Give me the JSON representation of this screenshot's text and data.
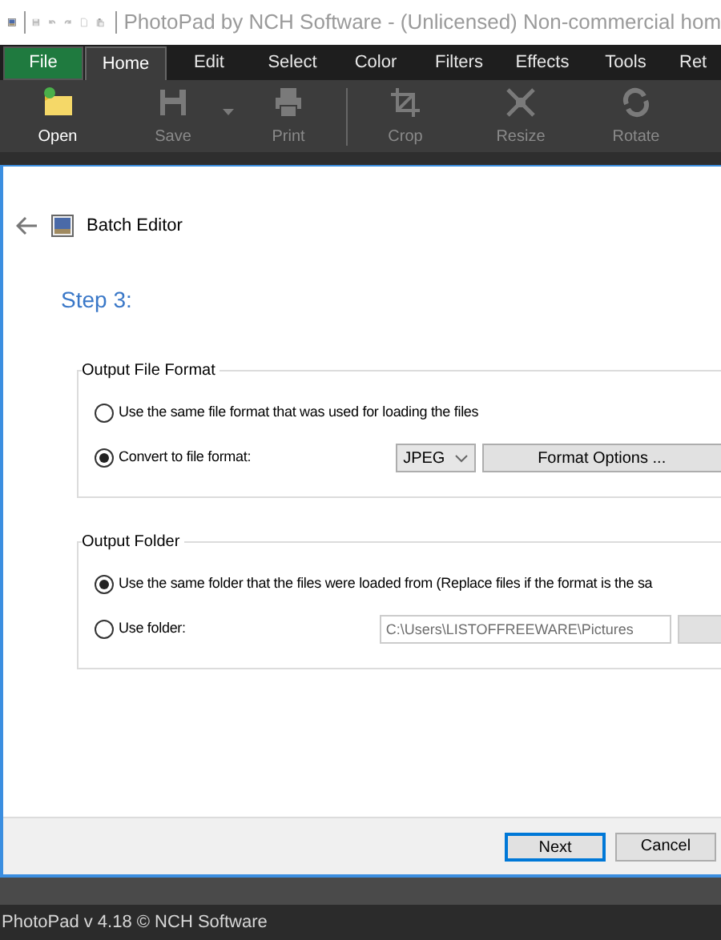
{
  "title_bar": {
    "title": "PhotoPad by NCH Software - (Unlicensed) Non-commercial hom"
  },
  "menu_tabs": [
    {
      "label": "File",
      "kind": "file",
      "selected": false
    },
    {
      "label": "Home",
      "kind": "tab",
      "selected": true
    },
    {
      "label": "Edit",
      "kind": "tab",
      "selected": false
    },
    {
      "label": "Select",
      "kind": "tab",
      "selected": false
    },
    {
      "label": "Color",
      "kind": "tab",
      "selected": false
    },
    {
      "label": "Filters",
      "kind": "tab",
      "selected": false
    },
    {
      "label": "Effects",
      "kind": "tab",
      "selected": false
    },
    {
      "label": "Tools",
      "kind": "tab",
      "selected": false
    },
    {
      "label": "Ret",
      "kind": "tab",
      "selected": false
    }
  ],
  "toolbar": [
    {
      "label": "Open",
      "kind": "open",
      "disabled": false,
      "dropdown": false
    },
    {
      "label": "Save",
      "kind": "save",
      "disabled": true,
      "dropdown": true
    },
    {
      "label": "Print",
      "kind": "print",
      "disabled": true,
      "dropdown": false
    },
    {
      "label": "Crop",
      "kind": "crop",
      "disabled": true,
      "dropdown": false
    },
    {
      "label": "Resize",
      "kind": "resize",
      "disabled": true,
      "dropdown": false
    },
    {
      "label": "Rotate",
      "kind": "rotate",
      "disabled": true,
      "dropdown": false
    }
  ],
  "dialog": {
    "title": "Batch Editor",
    "step": "Step 3:",
    "format_group": {
      "legend": "Output File Format",
      "options": [
        {
          "label": "Use the same file format that was used for loading the files",
          "selected": false
        },
        {
          "label": "Convert to file format:",
          "selected": true
        }
      ],
      "format_select": {
        "value": "JPEG"
      },
      "options_button": "Format Options ..."
    },
    "folder_group": {
      "legend": "Output Folder",
      "options": [
        {
          "label": "Use the same folder that the files were loaded from (Replace files if the format is the sa",
          "selected": true
        },
        {
          "label": "Use folder:",
          "selected": false
        }
      ],
      "folder_field": {
        "value": "C:\\Users\\LISTOFFREEWARE\\Pictures"
      }
    },
    "buttons": [
      "Next",
      "Cancel"
    ]
  },
  "status_bar": "PhotoPad v 4.18 © NCH Software"
}
